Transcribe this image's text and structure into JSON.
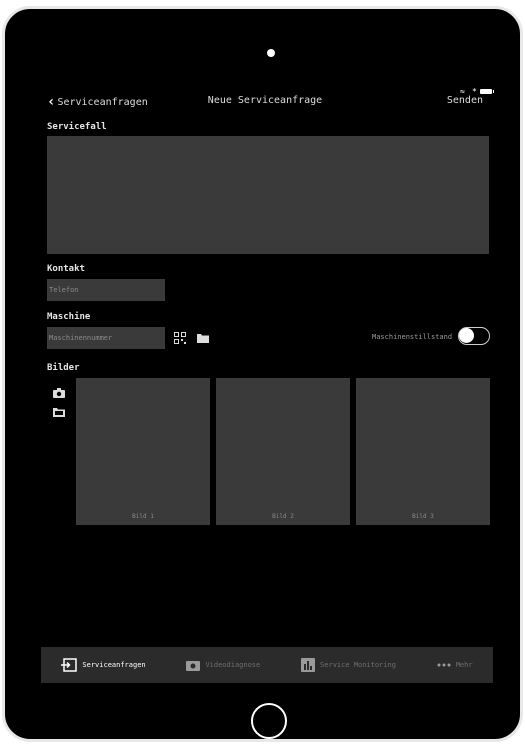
{
  "nav": {
    "back_label": "Serviceanfragen",
    "title": "Neue Serviceanfrage",
    "send_label": "Senden"
  },
  "form": {
    "servicefall_label": "Servicefall",
    "kontakt_label": "Kontakt",
    "telefon_placeholder": "Telefon",
    "maschine_label": "Maschine",
    "maschinennummer_placeholder": "Maschinennummer",
    "stillstand_label": "Maschinenstillstand",
    "bilder_label": "Bilder"
  },
  "photos": [
    {
      "caption": "Bild 1"
    },
    {
      "caption": "Bild 2"
    },
    {
      "caption": "Bild 3"
    }
  ],
  "tabs": [
    {
      "label": "Serviceanfragen",
      "icon": "login-icon",
      "active": true
    },
    {
      "label": "Videodiagnose",
      "icon": "camera-icon",
      "active": false
    },
    {
      "label": "Service Monitoring",
      "icon": "bar-chart-icon",
      "active": false
    },
    {
      "label": "Mehr",
      "icon": "more-icon",
      "active": false
    }
  ],
  "colors": {
    "background": "#000000",
    "field": "#3a3a3a",
    "tabbar": "#2b2b2b"
  }
}
